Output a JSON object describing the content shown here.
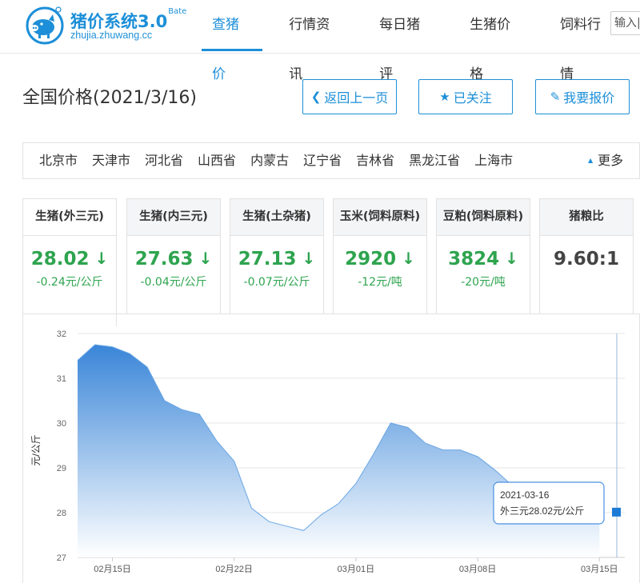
{
  "header": {
    "brand_name": "猪价系统3.0",
    "brand_tag": "Bate",
    "domain": "zhujia.zhuwang.cc",
    "search_placeholder": "输入|",
    "nav": [
      {
        "label": "查猪价",
        "active": true
      },
      {
        "label": "行情资讯",
        "active": false
      },
      {
        "label": "每日猪评",
        "active": false
      },
      {
        "label": "生猪价格",
        "active": false
      },
      {
        "label": "饲料行情",
        "active": false
      }
    ]
  },
  "page": {
    "title": "全国价格(2021/3/16)",
    "back_label": "返回上一页",
    "follow_label": "已关注",
    "quote_label": "我要报价"
  },
  "provinces": {
    "items": [
      "北京市",
      "天津市",
      "河北省",
      "山西省",
      "内蒙古",
      "辽宁省",
      "吉林省",
      "黑龙江省",
      "上海市"
    ],
    "more_label": "更多"
  },
  "cards": [
    {
      "title": "生猪(外三元)",
      "value": "28.02",
      "arrow": "↓",
      "change": "-0.24元/公斤",
      "active": true
    },
    {
      "title": "生猪(内三元)",
      "value": "27.63",
      "arrow": "↓",
      "change": "-0.04元/公斤",
      "active": false
    },
    {
      "title": "生猪(土杂猪)",
      "value": "27.13",
      "arrow": "↓",
      "change": "-0.07元/公斤",
      "active": false
    },
    {
      "title": "玉米(饲料原料)",
      "value": "2920",
      "arrow": "↓",
      "change": "-12元/吨",
      "active": false
    },
    {
      "title": "豆粕(饲料原料)",
      "value": "3824",
      "arrow": "↓",
      "change": "-20元/吨",
      "active": false
    },
    {
      "title": "猪粮比",
      "value": "9.60:1",
      "arrow": "",
      "change": "",
      "active": false
    }
  ],
  "colors": {
    "accent": "#1d8fd8",
    "down_green": "#2ea44f",
    "area_top": "#2f7fd6",
    "area_bottom": "#ffffff"
  },
  "chart_data": {
    "type": "area",
    "ylabel": "元/公斤",
    "ylim": [
      27,
      32
    ],
    "yticks": [
      27,
      28,
      29,
      30,
      31,
      32
    ],
    "xticks": [
      "02月15日",
      "02月22日",
      "03月01日",
      "03月08日",
      "03月15日"
    ],
    "x": [
      "2021-02-13",
      "2021-02-14",
      "2021-02-15",
      "2021-02-16",
      "2021-02-17",
      "2021-02-18",
      "2021-02-19",
      "2021-02-20",
      "2021-02-21",
      "2021-02-22",
      "2021-02-23",
      "2021-02-24",
      "2021-02-25",
      "2021-02-26",
      "2021-02-27",
      "2021-02-28",
      "2021-03-01",
      "2021-03-02",
      "2021-03-03",
      "2021-03-04",
      "2021-03-05",
      "2021-03-06",
      "2021-03-07",
      "2021-03-08",
      "2021-03-09",
      "2021-03-10",
      "2021-03-11",
      "2021-03-12",
      "2021-03-13",
      "2021-03-14",
      "2021-03-15",
      "2021-03-16"
    ],
    "series": [
      {
        "name": "外三元",
        "values": [
          31.4,
          31.75,
          31.7,
          31.55,
          31.25,
          30.5,
          30.3,
          30.2,
          29.6,
          29.15,
          28.1,
          27.8,
          27.7,
          27.6,
          27.95,
          28.2,
          28.65,
          29.3,
          30.0,
          29.9,
          29.55,
          29.4,
          29.4,
          29.25,
          28.95,
          28.6,
          28.4,
          28.25,
          28.2,
          28.15,
          28.1,
          28.02
        ]
      }
    ],
    "tooltip": {
      "date": "2021-03-16",
      "text": "外三元28.02元/公斤"
    },
    "grid": true
  }
}
